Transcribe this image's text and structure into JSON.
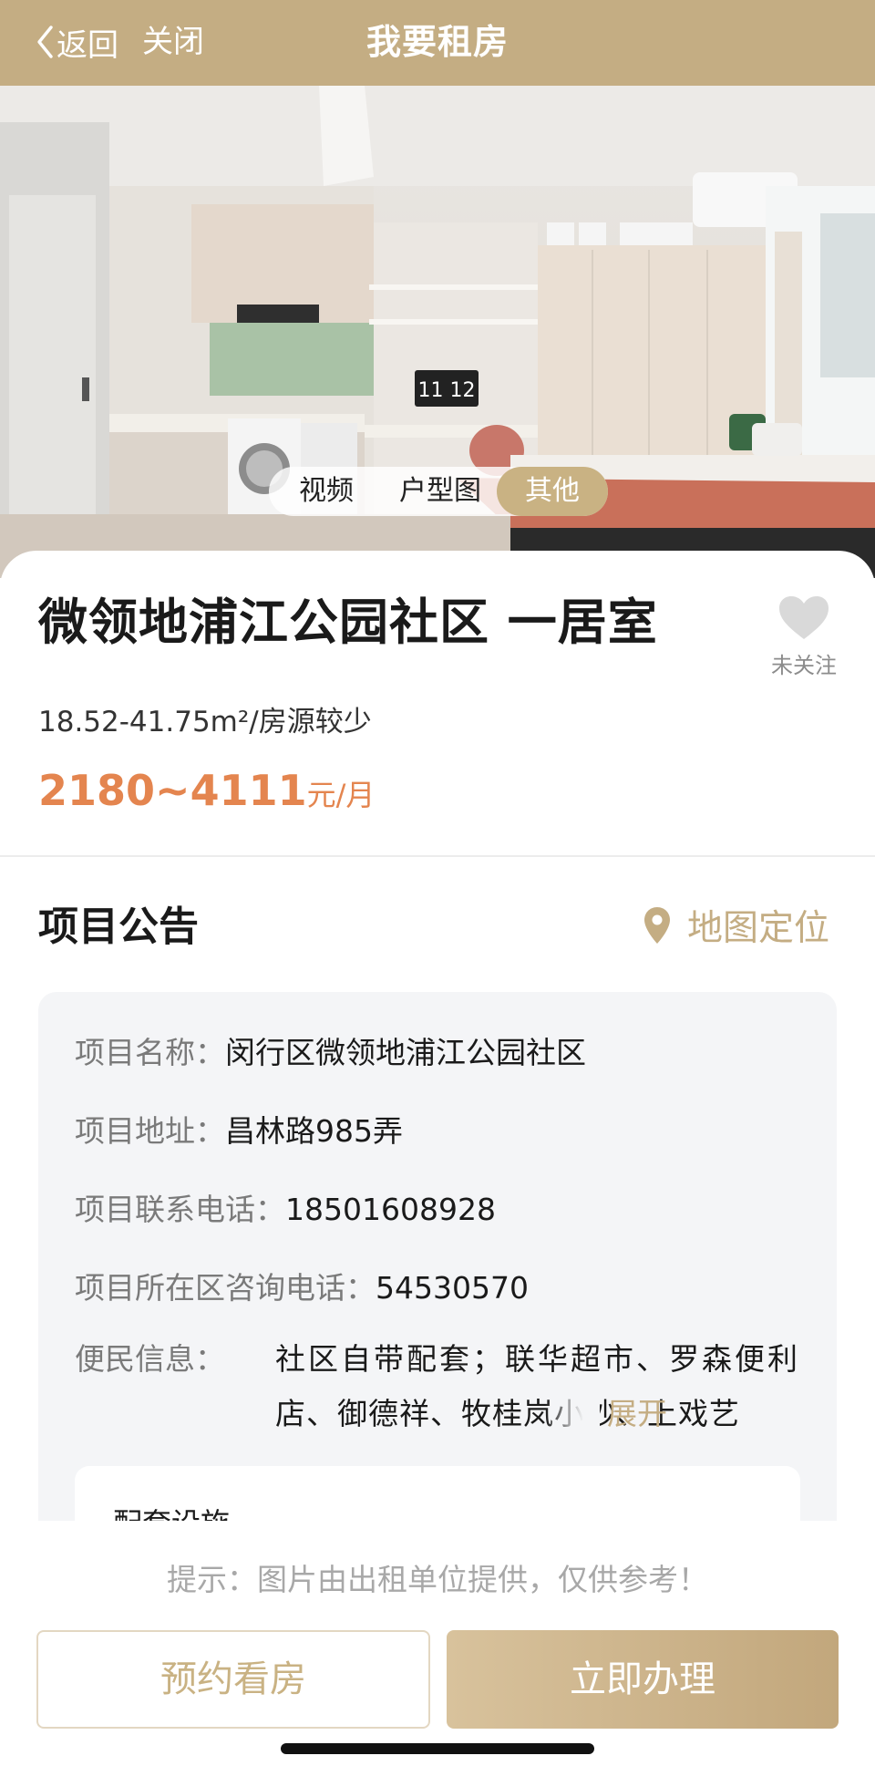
{
  "header": {
    "back_label": "返回",
    "close_label": "关闭",
    "title": "我要租房"
  },
  "media_tabs": [
    "视频",
    "户型图",
    "其他"
  ],
  "media_tabs_active": "其他",
  "property": {
    "title": "微领地浦江公园社区 一居室",
    "follow_label": "未关注",
    "area_info": "18.52-41.75m²/房源较少",
    "price_range": "2180~4111",
    "price_unit": "元/月"
  },
  "notice": {
    "title": "项目公告",
    "map_label": "地图定位",
    "items": [
      {
        "key": "项目名称：",
        "value": "闵行区微领地浦江公园社区"
      },
      {
        "key": "项目地址：",
        "value": "昌林路985弄"
      },
      {
        "key": "项目联系电话：",
        "value": "18501608928"
      },
      {
        "key": "项目所在区咨询电话：",
        "value": "54530570"
      }
    ],
    "convenience": {
      "key": "便民信息：",
      "line1": "社区自带配套；联华超市、罗森便利",
      "line2": "店、御德祥、牧桂岚小炒、上戏艺",
      "expand_label": "展开"
    },
    "facilities_title": "配套设施"
  },
  "footer": {
    "tip": "提示：图片由出租单位提供，仅供参考！",
    "reserve_label": "预约看房",
    "apply_label": "立即办理"
  },
  "hero_clock_text": "11 12",
  "colors": {
    "brand_gold": "#c4ad83",
    "price_orange": "#e4854f",
    "notice_bg": "#f4f5f7"
  }
}
